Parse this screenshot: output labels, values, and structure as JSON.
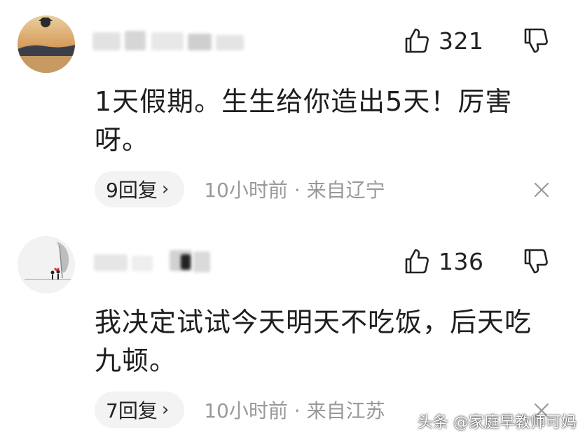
{
  "comments": [
    {
      "likes": "321",
      "text": "1天假期。生生给你造出5天！厉害呀。",
      "replies": "9回复",
      "meta": "10小时前 · 来自辽宁"
    },
    {
      "likes": "136",
      "text": "我决定试试今天明天不吃饭，后天吃九顿。",
      "replies": "7回复",
      "meta": "10小时前 · 来自江苏"
    }
  ],
  "icons": {
    "like": "thumbs-up-icon",
    "dislike": "thumbs-down-icon",
    "close": "close-icon",
    "chevron": "chevron-right-icon"
  },
  "reply_chevron": "›",
  "watermark": "头条 @家庭早教师可妈",
  "colors": {
    "text": "#1e1e1e",
    "meta": "#999999",
    "pill_bg": "#f3f3f3"
  }
}
